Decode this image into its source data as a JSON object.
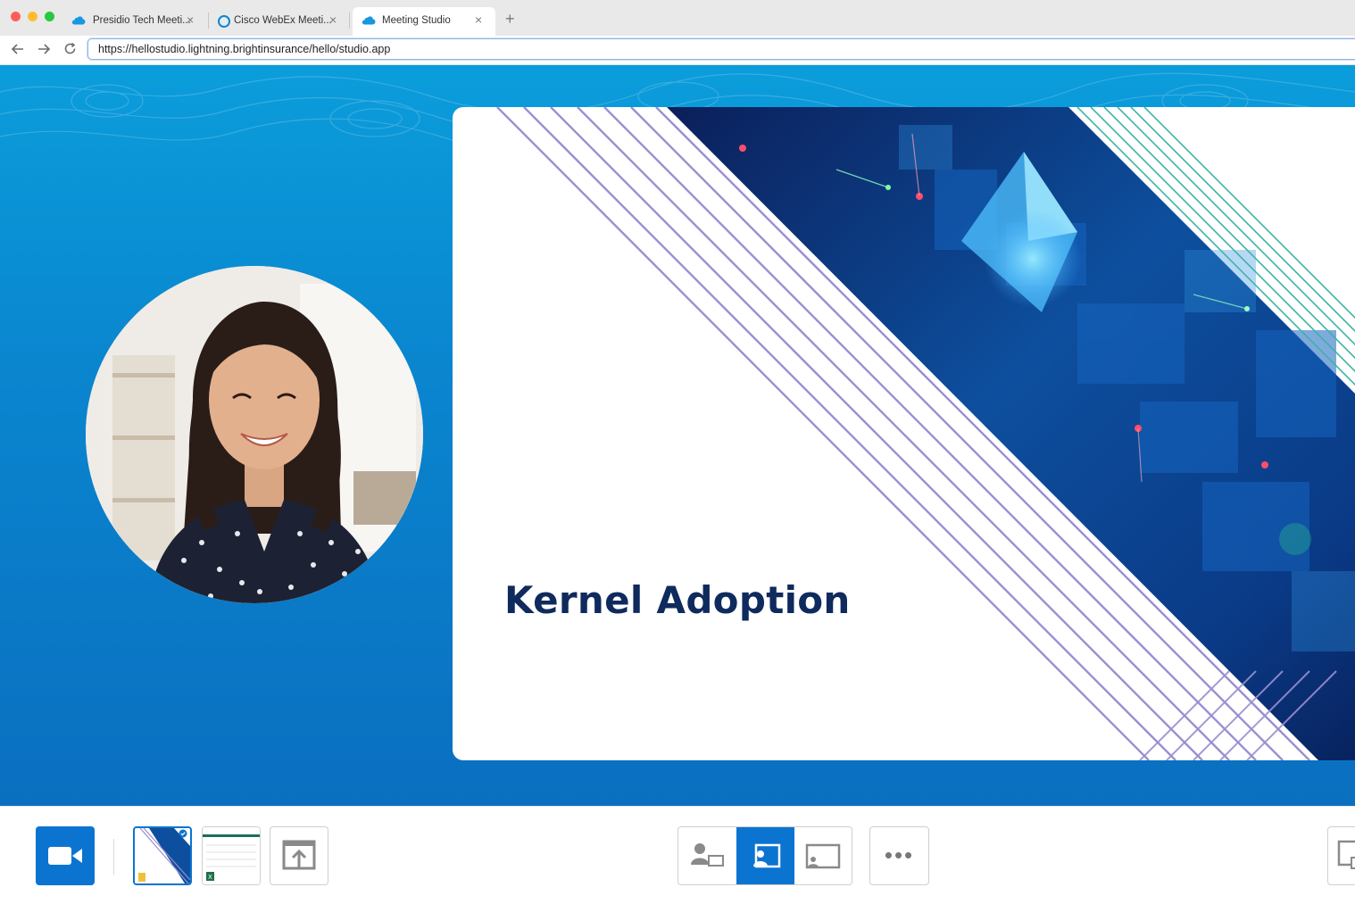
{
  "browser": {
    "tabs": [
      {
        "label": "Presidio Tech Meeti...",
        "icon": "salesforce-cloud-icon"
      },
      {
        "label": "Cisco WebEx Meeti...",
        "icon": "webex-icon"
      },
      {
        "label": "Meeting Studio",
        "icon": "salesforce-cloud-icon",
        "active": true
      }
    ],
    "close_glyph": "×",
    "new_tab_glyph": "+",
    "url": "https://hellostudio.lightning.brightinsurance/hello/studio.app"
  },
  "slide": {
    "title": "Kernel Adoption"
  },
  "toolbar": {
    "more_glyph": "•••",
    "layouts": [
      "presenter-and-content",
      "content-with-presenter-inset",
      "content-only"
    ],
    "active_layout": "content-with-presenter-inset"
  },
  "colors": {
    "accent": "#0b74d1",
    "stage_top": "#0b9ddb",
    "stage_bottom": "#0a6fc0",
    "title": "#0f2a5c",
    "stripe": "#9b8fd1"
  }
}
